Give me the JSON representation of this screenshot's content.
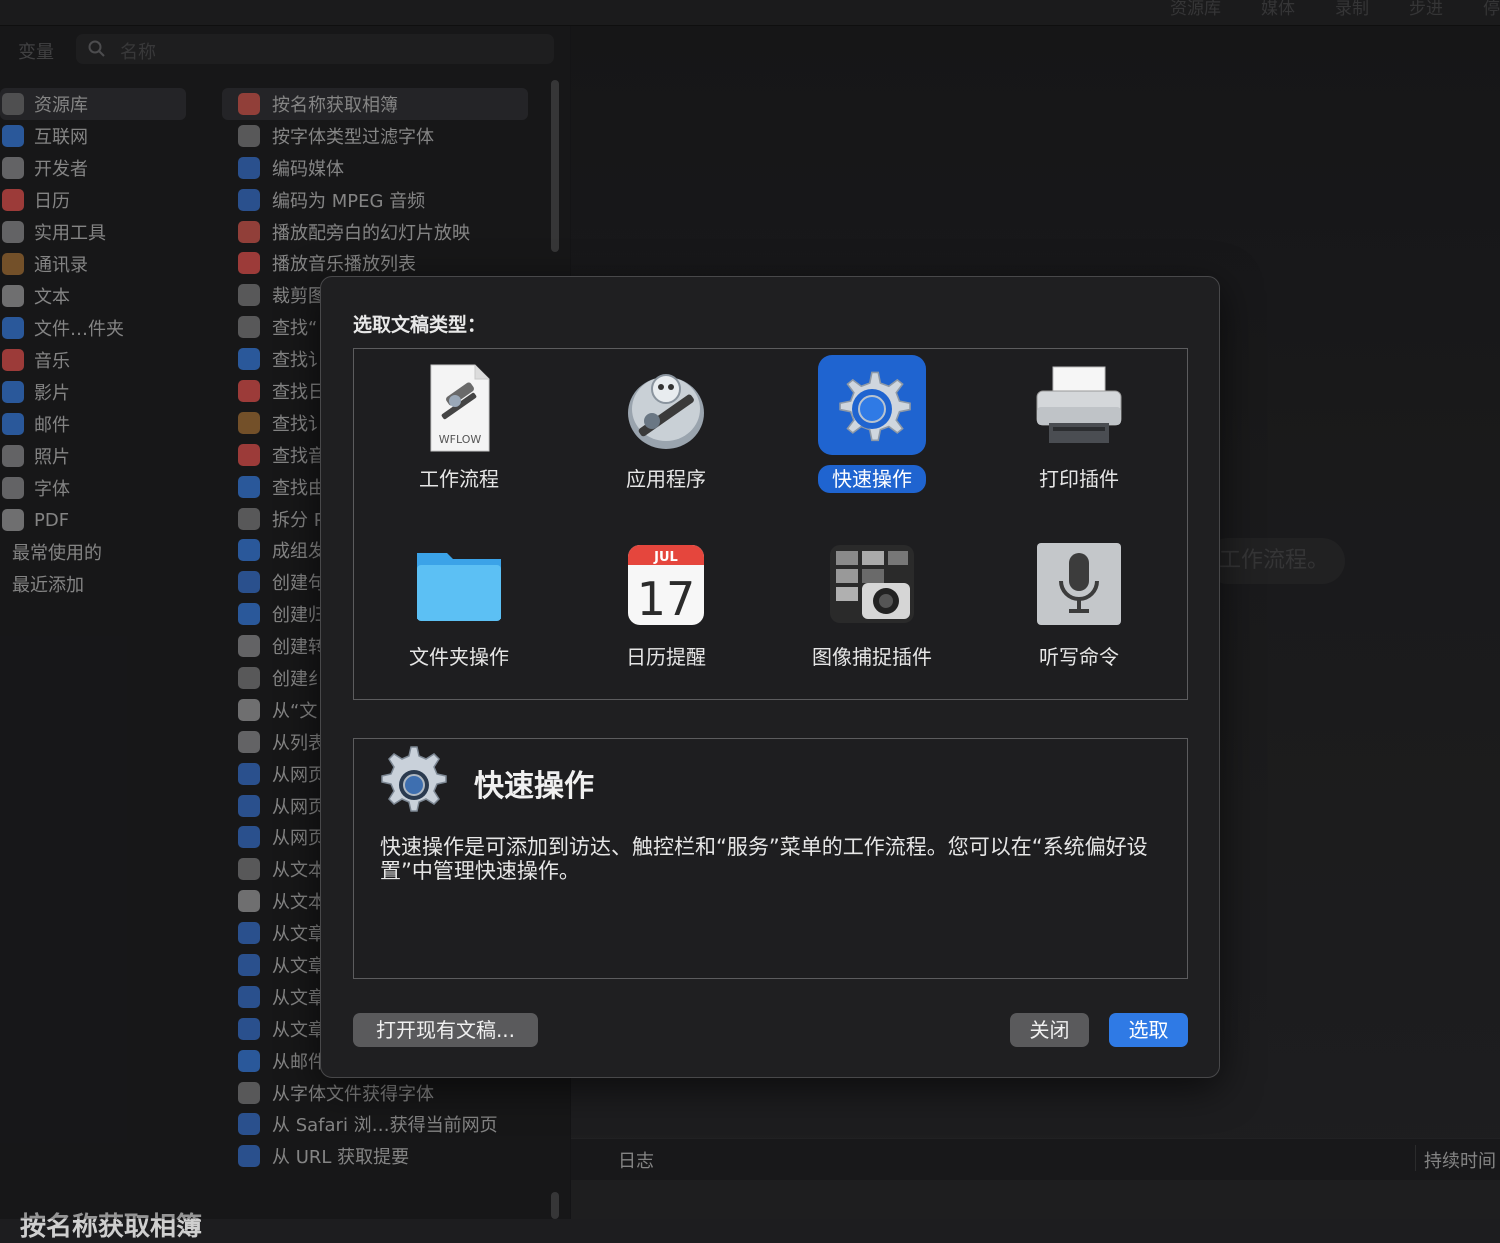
{
  "topbar": {
    "tabs": [
      "资源库",
      "媒体",
      "录制",
      "步进",
      "停"
    ]
  },
  "search": {
    "var_tab": "变量",
    "placeholder": "名称"
  },
  "library": {
    "items": [
      {
        "label": "资源库",
        "icon": "folder-icon",
        "color": "#6e6e70"
      },
      {
        "label": "互联网",
        "icon": "globe-icon",
        "color": "#3b7bd6"
      },
      {
        "label": "开发者",
        "icon": "tools-icon",
        "color": "#8a8a8c"
      },
      {
        "label": "日历",
        "icon": "calendar-icon",
        "color": "#d9534f"
      },
      {
        "label": "实用工具",
        "icon": "tools-icon",
        "color": "#8a8a8c"
      },
      {
        "label": "通讯录",
        "icon": "contacts-icon",
        "color": "#a0703a"
      },
      {
        "label": "文本",
        "icon": "text-icon",
        "color": "#9a9a9c"
      },
      {
        "label": "文件…件夹",
        "icon": "finder-icon",
        "color": "#3b7bd6"
      },
      {
        "label": "音乐",
        "icon": "music-icon",
        "color": "#d9534f"
      },
      {
        "label": "影片",
        "icon": "quicktime-icon",
        "color": "#3b7bd6"
      },
      {
        "label": "邮件",
        "icon": "mail-icon",
        "color": "#3b7bd6"
      },
      {
        "label": "照片",
        "icon": "photo-icon",
        "color": "#8a8a8c"
      },
      {
        "label": "字体",
        "icon": "font-icon",
        "color": "#8a8a8c"
      },
      {
        "label": "PDF",
        "icon": "pdf-icon",
        "color": "#9a9a9c"
      },
      {
        "label": "最常使用的",
        "icon": "",
        "color": ""
      },
      {
        "label": "最近添加",
        "icon": "",
        "color": ""
      }
    ]
  },
  "actions": {
    "items": [
      {
        "label": "按名称获取相簿",
        "color": "#c9584f"
      },
      {
        "label": "按字体类型过滤字体",
        "color": "#7a7a7c"
      },
      {
        "label": "编码媒体",
        "color": "#3b6fc4"
      },
      {
        "label": "编码为 MPEG 音频",
        "color": "#3b6fc4"
      },
      {
        "label": "播放配旁白的幻灯片放映",
        "color": "#c9584f"
      },
      {
        "label": "播放音乐播放列表",
        "color": "#d9534f"
      },
      {
        "label": "裁剪图",
        "color": "#7a7a7c"
      },
      {
        "label": "查找“",
        "color": "#7a7a7c"
      },
      {
        "label": "查找讠",
        "color": "#3b7bd6"
      },
      {
        "label": "查找日",
        "color": "#d9534f"
      },
      {
        "label": "查找讠",
        "color": "#a0703a"
      },
      {
        "label": "查找音",
        "color": "#d9534f"
      },
      {
        "label": "查找由",
        "color": "#3b7bd6"
      },
      {
        "label": "拆分 P",
        "color": "#7a7a7c"
      },
      {
        "label": "成组发",
        "color": "#3b7bd6"
      },
      {
        "label": "创建句",
        "color": "#3b6fc4"
      },
      {
        "label": "创建归",
        "color": "#3b7bd6"
      },
      {
        "label": "创建转",
        "color": "#8a8a8c"
      },
      {
        "label": "创建纟",
        "color": "#7a7a7c"
      },
      {
        "label": "从“文",
        "color": "#9a9a9c"
      },
      {
        "label": "从列表",
        "color": "#8a8a8c"
      },
      {
        "label": "从网页",
        "color": "#3b6fc4"
      },
      {
        "label": "从网页",
        "color": "#3b6fc4"
      },
      {
        "label": "从网页",
        "color": "#3b6fc4"
      },
      {
        "label": "从文本",
        "color": "#7a7a7c"
      },
      {
        "label": "从文本",
        "color": "#9a9a9c"
      },
      {
        "label": "从文章",
        "color": "#3b6fc4"
      },
      {
        "label": "从文章",
        "color": "#3b6fc4"
      },
      {
        "label": "从文章",
        "color": "#3b6fc4"
      },
      {
        "label": "从文章",
        "color": "#3b6fc4"
      },
      {
        "label": "从邮件",
        "color": "#3b7bd6"
      },
      {
        "label": "从字体文件获得字体",
        "color": "#7a7a7c"
      },
      {
        "label": "从 Safari 浏…获得当前网页",
        "color": "#3b6fc4"
      },
      {
        "label": "从 URL 获取提要",
        "color": "#3b6fc4"
      }
    ]
  },
  "bottom_title": "按名称获取相簿",
  "canvas_hint": "工作流程。",
  "log": {
    "label": "日志",
    "duration": "持续时间"
  },
  "dialog": {
    "prompt": "选取文稿类型：",
    "types": [
      {
        "label": "工作流程",
        "icon": "workflow-icon",
        "badge": "WFLOW"
      },
      {
        "label": "应用程序",
        "icon": "automator-icon"
      },
      {
        "label": "快速操作",
        "icon": "gear-icon",
        "selected": true
      },
      {
        "label": "打印插件",
        "icon": "printer-icon"
      },
      {
        "label": "文件夹操作",
        "icon": "folder-icon"
      },
      {
        "label": "日历提醒",
        "icon": "calendar-icon",
        "month": "JUL",
        "day": "17"
      },
      {
        "label": "图像捕捉插件",
        "icon": "camera-icon"
      },
      {
        "label": "听写命令",
        "icon": "microphone-icon"
      }
    ],
    "description": {
      "title": "快速操作",
      "text": "快速操作是可添加到访达、触控栏和“服务”菜单的工作流程。您可以在“系统偏好设置”中管理快速操作。"
    },
    "buttons": {
      "open": "打开现有文稿...",
      "close": "关闭",
      "choose": "选取"
    },
    "colors": {
      "accent": "#2f7ae5",
      "selection": "#1f64d0"
    }
  }
}
